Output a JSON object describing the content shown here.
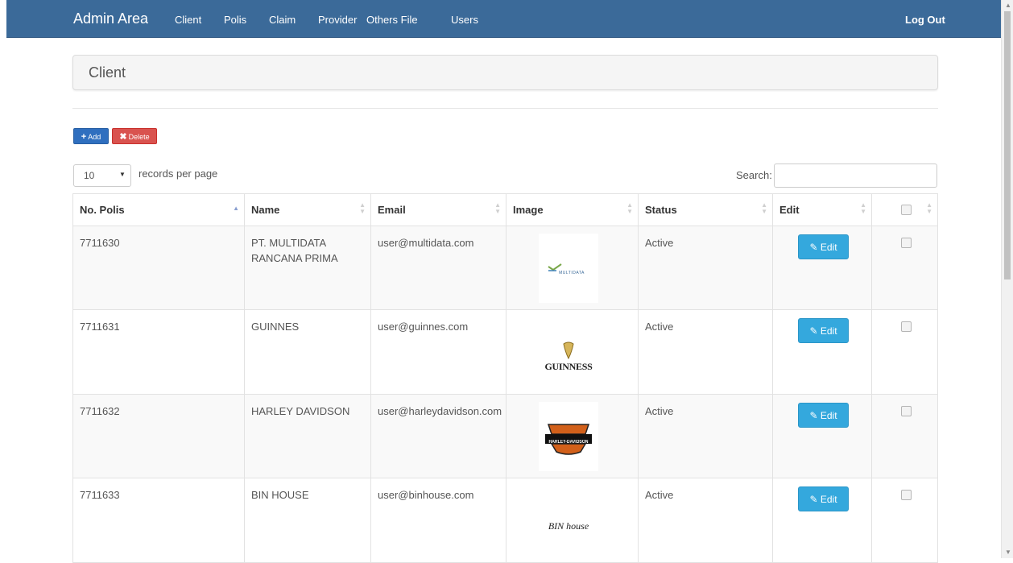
{
  "nav": {
    "brand": "Admin Area",
    "items": [
      "Client",
      "Polis",
      "Claim",
      "Provider",
      "Others File",
      "Users"
    ],
    "logout": "Log Out"
  },
  "panel": {
    "title": "Client"
  },
  "toolbar": {
    "add_label": "Add",
    "delete_label": "Delete"
  },
  "table_controls": {
    "page_length": "10",
    "page_length_label": "records per page",
    "search_label": "Search:",
    "search_value": ""
  },
  "table": {
    "headers": [
      "No. Polis",
      "Name",
      "Email",
      "Image",
      "Status",
      "Edit"
    ],
    "edit_label": "Edit",
    "rows": [
      {
        "no_polis": "7711630",
        "name": "PT. MULTIDATA RANCANA PRIMA",
        "email": "user@multidata.com",
        "image": "MULTIDATA",
        "status": "Active"
      },
      {
        "no_polis": "7711631",
        "name": "GUINNES",
        "email": "user@guinnes.com",
        "image": "GUINNESS",
        "status": "Active"
      },
      {
        "no_polis": "7711632",
        "name": "HARLEY DAVIDSON",
        "email": "user@harleydavidson.com",
        "image": "HARLEY-DAVIDSON",
        "status": "Active"
      },
      {
        "no_polis": "7711633",
        "name": "BIN HOUSE",
        "email": "user@binhouse.com",
        "image": "BIN house",
        "status": "Active"
      }
    ]
  },
  "colors": {
    "navbar": "#3b6a99",
    "add_button": "#2f6fbf",
    "delete_button": "#d9534f",
    "edit_button": "#34a8dd"
  },
  "icons": {
    "add": "plus-icon",
    "delete": "x-icon",
    "edit": "pencil-icon",
    "length": "caret-down-icon",
    "sort": "sort-icon"
  }
}
